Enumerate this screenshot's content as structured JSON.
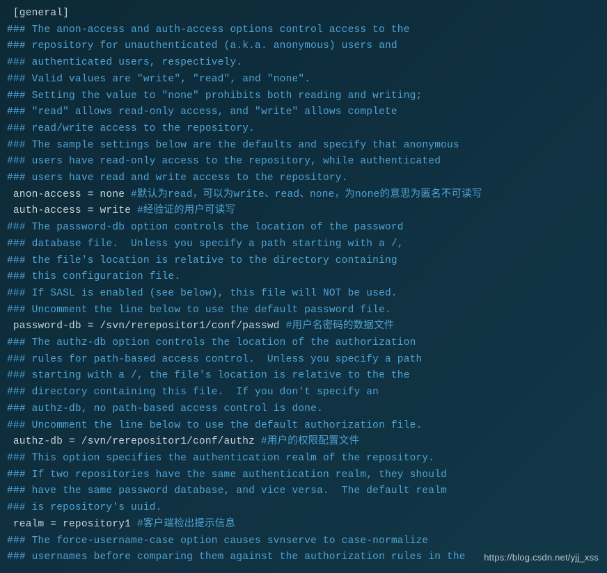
{
  "watermark": "https://blog.csdn.net/yjj_xss",
  "lines": [
    {
      "segs": [
        {
          "t": "comment",
          "s": " "
        },
        {
          "t": "plain",
          "s": "[general]"
        }
      ]
    },
    {
      "segs": [
        {
          "t": "comment",
          "s": "### The anon-access and auth-access options control access to the"
        }
      ]
    },
    {
      "segs": [
        {
          "t": "comment",
          "s": "### repository for unauthenticated (a.k.a. anonymous) users and"
        }
      ]
    },
    {
      "segs": [
        {
          "t": "comment",
          "s": "### authenticated users, respectively."
        }
      ]
    },
    {
      "segs": [
        {
          "t": "comment",
          "s": "### Valid values are \"write\", \"read\", and \"none\"."
        }
      ]
    },
    {
      "segs": [
        {
          "t": "comment",
          "s": "### Setting the value to \"none\" prohibits both reading and writing;"
        }
      ]
    },
    {
      "segs": [
        {
          "t": "comment",
          "s": "### \"read\" allows read-only access, and \"write\" allows complete"
        }
      ]
    },
    {
      "segs": [
        {
          "t": "comment",
          "s": "### read/write access to the repository."
        }
      ]
    },
    {
      "segs": [
        {
          "t": "comment",
          "s": "### The sample settings below are the defaults and specify that anonymous"
        }
      ]
    },
    {
      "segs": [
        {
          "t": "comment",
          "s": "### users have read-only access to the repository, while authenticated"
        }
      ]
    },
    {
      "segs": [
        {
          "t": "comment",
          "s": "### users have read and write access to the repository."
        }
      ]
    },
    {
      "segs": [
        {
          "t": "plain",
          "s": " anon-access = none "
        },
        {
          "t": "comment",
          "s": "#默认为read，可以为write、read、none，为none的意思为匿名不可读写"
        }
      ]
    },
    {
      "segs": [
        {
          "t": "plain",
          "s": " auth-access = write "
        },
        {
          "t": "comment",
          "s": "#经验证的用户可读写"
        }
      ]
    },
    {
      "segs": [
        {
          "t": "comment",
          "s": "### The password-db option controls the location of the password"
        }
      ]
    },
    {
      "segs": [
        {
          "t": "comment",
          "s": "### database file.  Unless you specify a path starting with a /,"
        }
      ]
    },
    {
      "segs": [
        {
          "t": "comment",
          "s": "### the file's location is relative to the directory containing"
        }
      ]
    },
    {
      "segs": [
        {
          "t": "comment",
          "s": "### this configuration file."
        }
      ]
    },
    {
      "segs": [
        {
          "t": "comment",
          "s": "### If SASL is enabled (see below), this file will NOT be used."
        }
      ]
    },
    {
      "segs": [
        {
          "t": "comment",
          "s": "### Uncomment the line below to use the default password file."
        }
      ]
    },
    {
      "segs": [
        {
          "t": "plain",
          "s": " password-db = /svn/rerepositor1/conf/passwd "
        },
        {
          "t": "comment",
          "s": "#用户名密码的数据文件"
        }
      ]
    },
    {
      "segs": [
        {
          "t": "comment",
          "s": "### The authz-db option controls the location of the authorization"
        }
      ]
    },
    {
      "segs": [
        {
          "t": "comment",
          "s": "### rules for path-based access control.  Unless you specify a path"
        }
      ]
    },
    {
      "segs": [
        {
          "t": "comment",
          "s": "### starting with a /, the file's location is relative to the the"
        }
      ]
    },
    {
      "segs": [
        {
          "t": "comment",
          "s": "### directory containing this file.  If you don't specify an"
        }
      ]
    },
    {
      "segs": [
        {
          "t": "comment",
          "s": "### authz-db, no path-based access control is done."
        }
      ]
    },
    {
      "segs": [
        {
          "t": "comment",
          "s": "### Uncomment the line below to use the default authorization file."
        }
      ]
    },
    {
      "segs": [
        {
          "t": "plain",
          "s": " authz-db = /svn/rerepositor1/conf/authz "
        },
        {
          "t": "comment",
          "s": "#用户的权限配置文件"
        }
      ]
    },
    {
      "segs": [
        {
          "t": "comment",
          "s": "### This option specifies the authentication realm of the repository."
        }
      ]
    },
    {
      "segs": [
        {
          "t": "comment",
          "s": "### If two repositories have the same authentication realm, they should"
        }
      ]
    },
    {
      "segs": [
        {
          "t": "comment",
          "s": "### have the same password database, and vice versa.  The default realm"
        }
      ]
    },
    {
      "segs": [
        {
          "t": "comment",
          "s": "### is repository's uuid."
        }
      ]
    },
    {
      "segs": [
        {
          "t": "plain",
          "s": " realm = repository1 "
        },
        {
          "t": "comment",
          "s": "#客户端检出提示信息"
        }
      ]
    },
    {
      "segs": [
        {
          "t": "comment",
          "s": "### The force-username-case option causes svnserve to case-normalize"
        }
      ]
    },
    {
      "segs": [
        {
          "t": "comment",
          "s": "### usernames before comparing them against the authorization rules in the"
        }
      ]
    }
  ]
}
